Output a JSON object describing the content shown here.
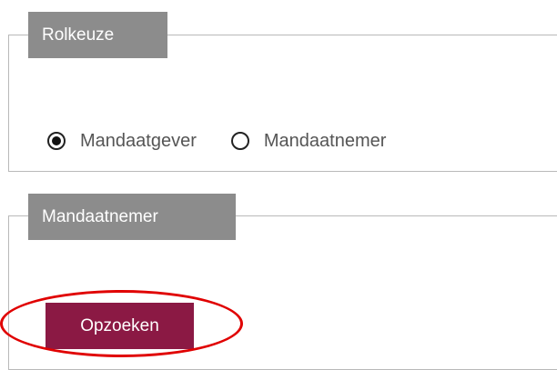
{
  "role_section": {
    "legend": "Rolkeuze",
    "options": [
      {
        "label": "Mandaatgever",
        "checked": true
      },
      {
        "label": "Mandaatnemer",
        "checked": false
      }
    ]
  },
  "mandatee_section": {
    "legend": "Mandaatnemer",
    "search_button_label": "Opzoeken"
  },
  "colors": {
    "legend_bg": "#8c8c8c",
    "button_bg": "#8b1944",
    "highlight": "#e00000"
  }
}
